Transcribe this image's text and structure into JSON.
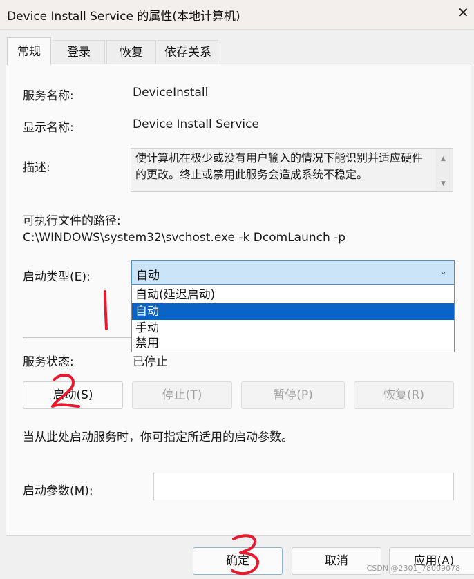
{
  "window": {
    "title": "Device Install Service 的属性(本地计算机)"
  },
  "tabs": [
    {
      "label": "常规",
      "active": true
    },
    {
      "label": "登录"
    },
    {
      "label": "恢复"
    },
    {
      "label": "依存关系"
    }
  ],
  "general": {
    "service_name_label": "服务名称:",
    "service_name": "DeviceInstall",
    "display_name_label": "显示名称:",
    "display_name": "Device Install Service",
    "description_label": "描述:",
    "description": "使计算机在极少或没有用户输入的情况下能识别并适应硬件的更改。终止或禁用此服务会造成系统不稳定。",
    "exe_path_label": "可执行文件的路径:",
    "exe_path": "C:\\WINDOWS\\system32\\svchost.exe -k DcomLaunch -p",
    "startup_type_label": "启动类型(E):",
    "startup_type_value": "自动",
    "startup_options": [
      "自动(延迟启动)",
      "自动",
      "手动",
      "禁用"
    ],
    "startup_selected_index": 1,
    "service_status_label": "服务状态:",
    "service_status": "已停止",
    "buttons": {
      "start": "启动(S)",
      "stop": "停止(T)",
      "pause": "暂停(P)",
      "resume": "恢复(R)"
    },
    "hint": "当从此处启动服务时，你可指定所适用的启动参数。",
    "start_params_label": "启动参数(M):",
    "start_params_value": ""
  },
  "footer": {
    "ok": "确定",
    "cancel": "取消",
    "apply": "应用(A)"
  },
  "annotations": {
    "marks": [
      "1",
      "2",
      "3"
    ],
    "color": "#e8192c"
  },
  "watermark": "CSDN @2301_78009078"
}
